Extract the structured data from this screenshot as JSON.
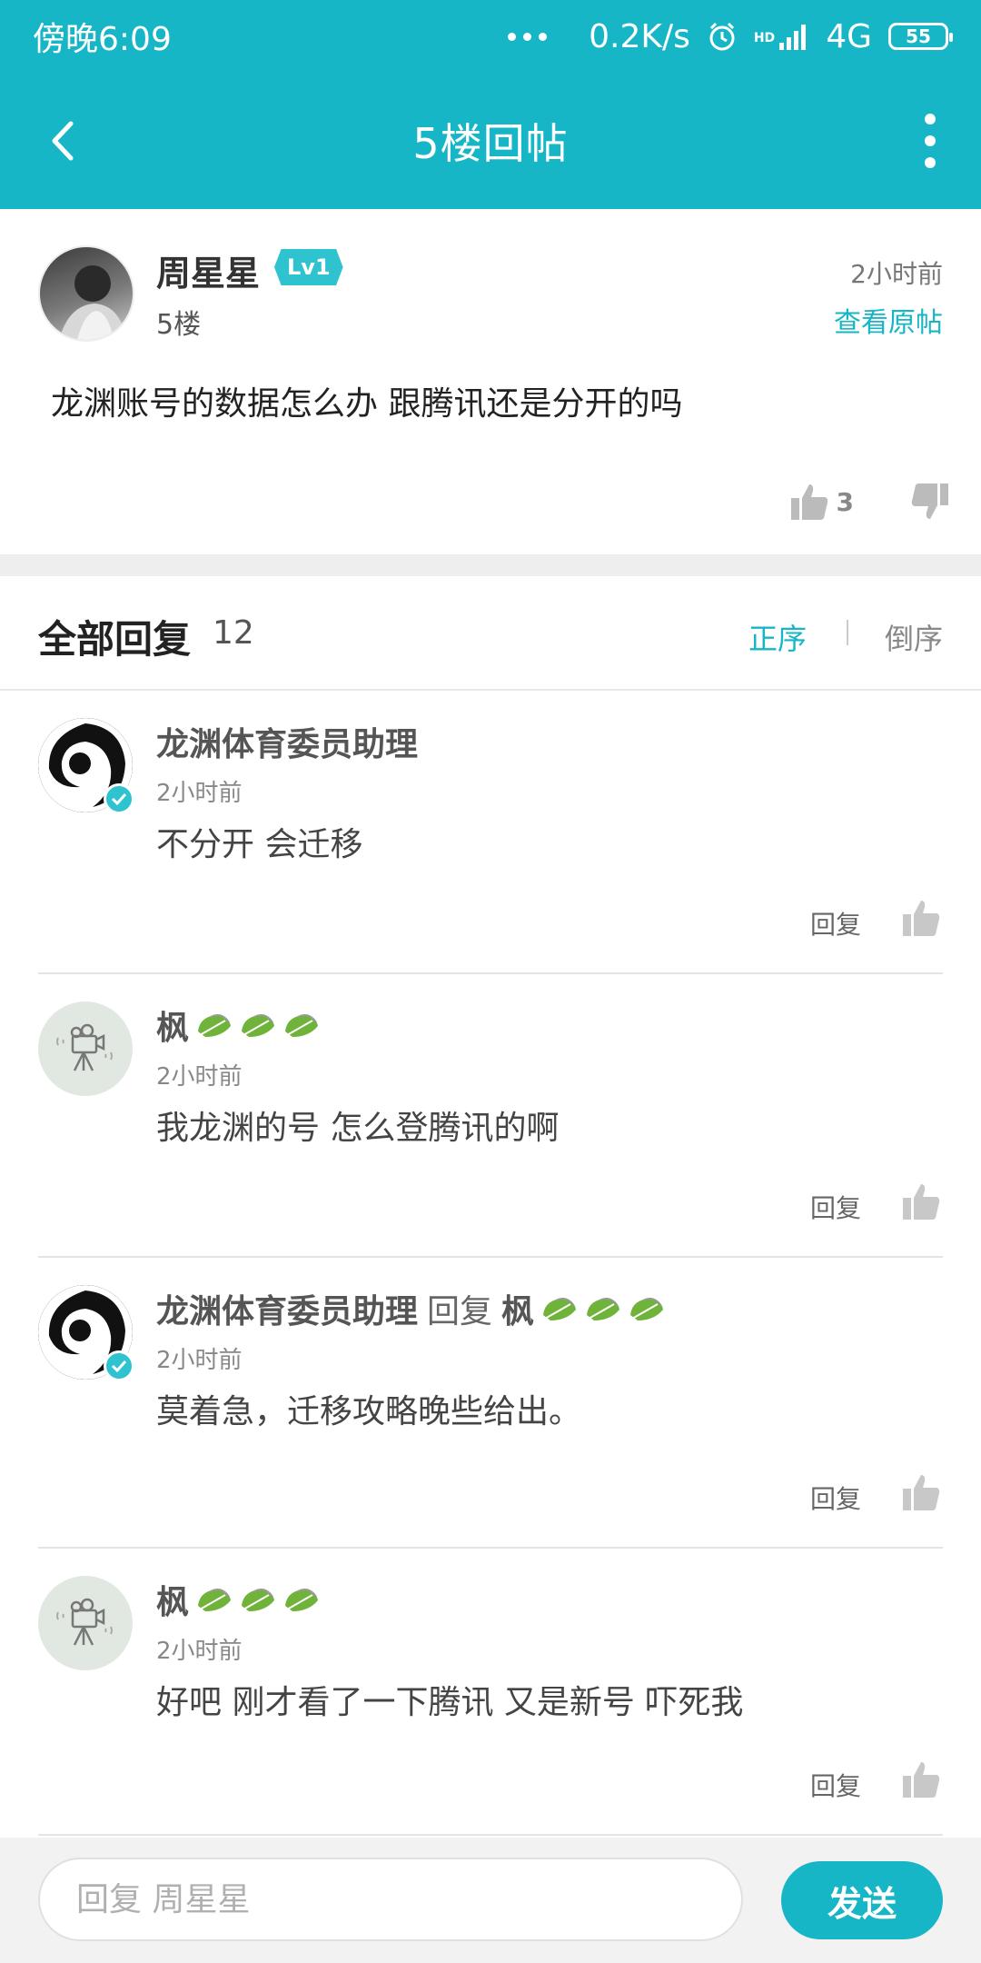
{
  "status_bar": {
    "time": "傍晚6:09",
    "network_speed": "0.2K/s",
    "hd_label": "HD",
    "network_type": "4G",
    "battery": "55"
  },
  "header": {
    "title": "5楼回帖",
    "back_icon": "back-arrow-icon",
    "more_icon": "more-vertical-icon"
  },
  "post": {
    "author": "周星星",
    "level": "Lv1",
    "floor": "5楼",
    "time": "2小时前",
    "view_original": "查看原帖",
    "content": "龙渊账号的数据怎么办 跟腾讯还是分开的吗",
    "likes": "3"
  },
  "replies_header": {
    "label": "全部回复",
    "count": "12",
    "sort_asc": "正序",
    "sort_desc": "倒序"
  },
  "replies": [
    {
      "author": "龙渊体育委员助理",
      "reply_label": "",
      "reply_to": "",
      "time": "2小时前",
      "content": "不分开 会迁移",
      "reply_button": "回复",
      "avatar": "dragon-logo",
      "verified": true
    },
    {
      "author": "枫",
      "reply_label": "",
      "reply_to": "",
      "time": "2小时前",
      "content": "我龙渊的号 怎么登腾讯的啊",
      "reply_button": "回复",
      "avatar": "camera-placeholder",
      "verified": false
    },
    {
      "author": "龙渊体育委员助理",
      "reply_label": "回复",
      "reply_to": "枫",
      "time": "2小时前",
      "content": "莫着急，迁移攻略晚些给出。",
      "reply_button": "回复",
      "avatar": "dragon-logo",
      "verified": true
    },
    {
      "author": "枫",
      "reply_label": "",
      "reply_to": "",
      "time": "2小时前",
      "content": "好吧 刚才看了一下腾讯 又是新号 吓死我",
      "reply_button": "回复",
      "avatar": "camera-placeholder",
      "verified": false
    }
  ],
  "composer": {
    "placeholder": "回复 周星星",
    "send_label": "发送"
  },
  "colors": {
    "accent": "#17b6c7",
    "level_badge": "#2ec3cf",
    "leaf_green": "#6fb33a"
  }
}
